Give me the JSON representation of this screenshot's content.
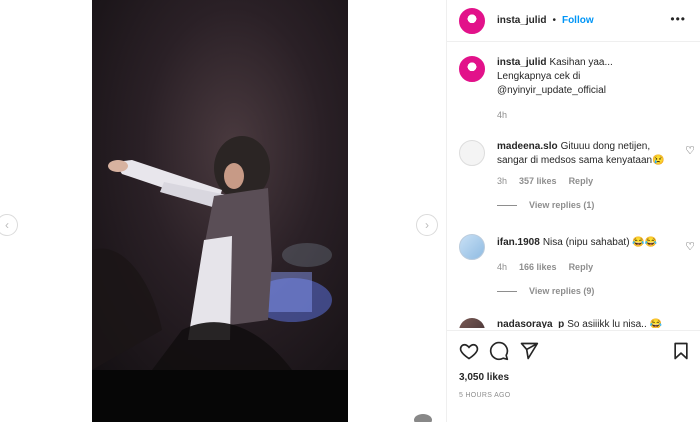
{
  "post": {
    "username": "insta_julid",
    "separator": "•",
    "follow": "Follow",
    "more_glyph": "•••"
  },
  "nav": {
    "left_glyph": "‹",
    "right_glyph": "›"
  },
  "caption": {
    "username": "insta_julid",
    "text_lines": [
      "Kasihan yaa...",
      "Lengkapnya cek di",
      "@nyinyir_update_official"
    ],
    "time": "4h"
  },
  "comments": [
    {
      "username": "madeena.slo",
      "text": "Gituuu dong netijen, sangar di medsos sama kenyataan😢",
      "time": "3h",
      "likes": "357 likes",
      "reply": "Reply",
      "view_replies": "View replies (1)"
    },
    {
      "username": "ifan.1908",
      "text": "Nisa (nipu sahabat) 😂😂",
      "time": "4h",
      "likes": "166 likes",
      "reply": "Reply",
      "view_replies": "View replies (9)"
    },
    {
      "username": "nadasoraya_p",
      "text": "So asiiikk lu nisa.. 😂"
    }
  ],
  "stats": {
    "likes": "3,050 likes",
    "posted": "5 HOURS AGO"
  },
  "icons": [
    "heart-icon",
    "comment-icon",
    "share-icon",
    "bookmark-icon",
    "more-icon"
  ]
}
